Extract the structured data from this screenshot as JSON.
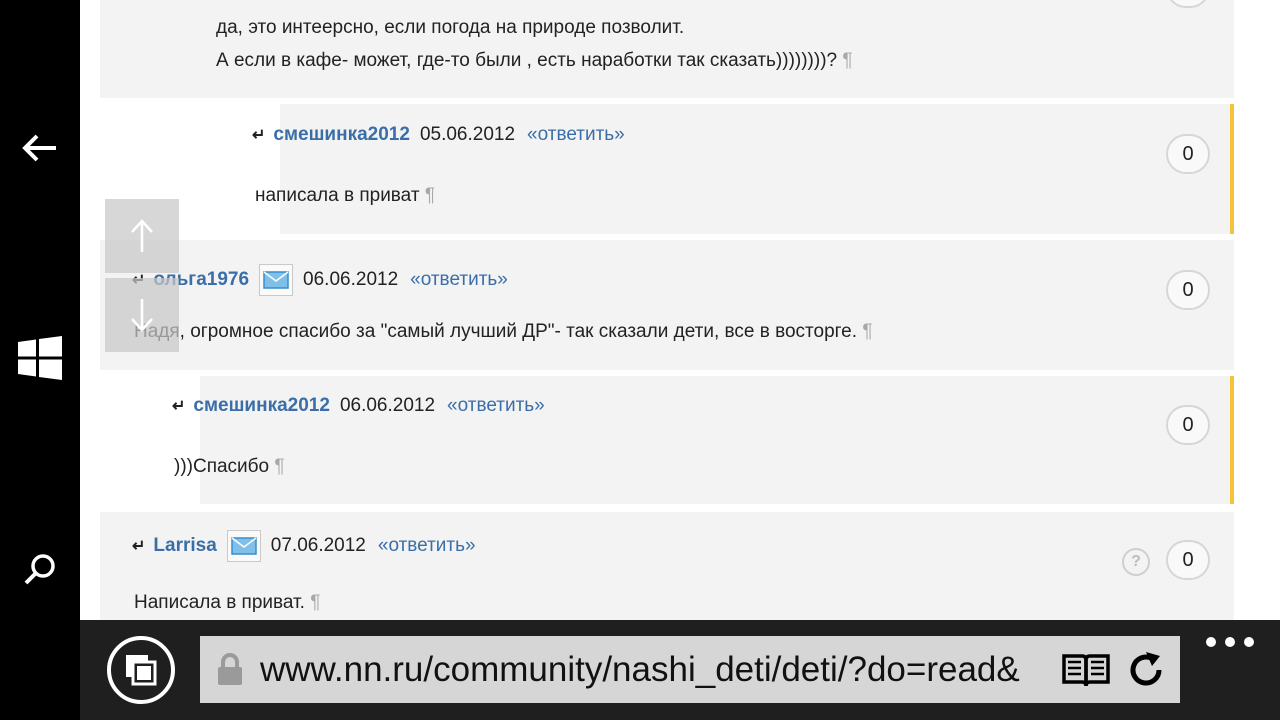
{
  "browser": {
    "url": "www.nn.ru/community/nashi_deti/deti/?do=read&",
    "icons": {
      "back": "back-arrow-icon",
      "start": "windows-logo-icon",
      "search": "search-icon",
      "tabs": "tabs-icon",
      "lock": "lock-icon",
      "reader": "reading-view-icon",
      "refresh": "refresh-icon",
      "more": "more-icon"
    }
  },
  "page": {
    "reply_label": "«ответить»",
    "pilcrow": "¶",
    "scroll_up": "↑",
    "scroll_down": "↓",
    "help": "?",
    "reply_arrow": "↵",
    "accent_color": "#f5c33b",
    "link_color": "#3a6ea8",
    "top_text": {
      "line1": "да, это интеерсно, если погода на природе позволит.",
      "line2": "А если в кафе- может, где-то были , есть наработки так сказать))))))))?"
    },
    "comments": [
      {
        "author": "смешинка2012",
        "date": "05.06.2012",
        "votes": "0",
        "text": "написала в приват"
      },
      {
        "author": "ольга1976",
        "date": "06.06.2012",
        "votes": "0",
        "text": "Надя, огромное спасибо за \"самый лучший ДР\"- так сказали дети, все в восторге."
      },
      {
        "author": "смешинка2012",
        "date": "06.06.2012",
        "votes": "0",
        "text": ")))Спасибо"
      },
      {
        "author": "Larrisa",
        "date": "07.06.2012",
        "votes": "0",
        "text": "Написала в приват."
      }
    ]
  }
}
